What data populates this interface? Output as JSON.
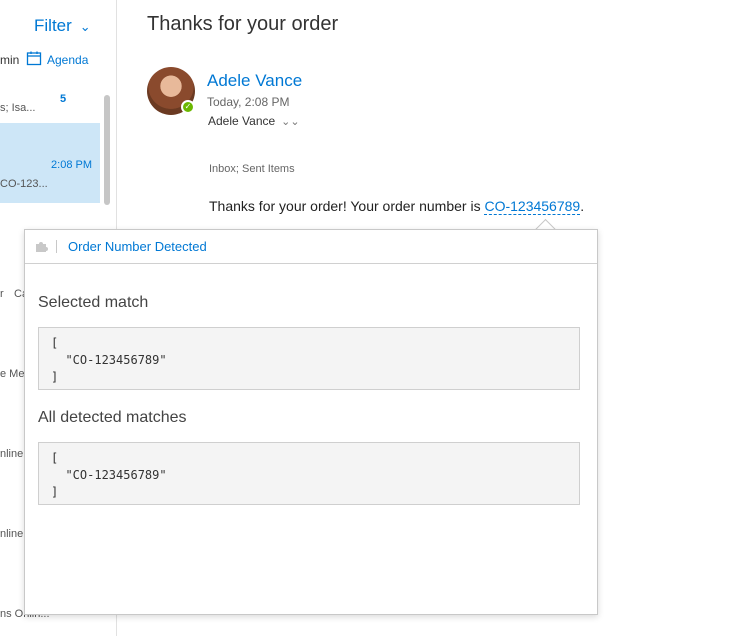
{
  "left_pane": {
    "filter_label": "Filter",
    "view_prefix": "min",
    "agenda_label": "Agenda",
    "messages": [
      {
        "snippet": "s; Isa...",
        "count": "5"
      },
      {
        "time": "2:08 PM",
        "snippet": "CO-123..."
      }
    ],
    "fragments": [
      "r",
      "Ca",
      "e Me",
      "nline",
      "nline",
      "ns Onlin..."
    ]
  },
  "reading_pane": {
    "subject": "Thanks for your order",
    "sender_name": "Adele Vance",
    "sent_time": "Today, 2:08 PM",
    "to": "Adele Vance",
    "folders": "Inbox; Sent Items",
    "body_prefix": "Thanks for your order! Your order number is ",
    "order_number": "CO-123456789",
    "body_suffix": "."
  },
  "callout": {
    "title": "Order Number Detected",
    "selected_label": "Selected match",
    "selected_code": [
      "[",
      "  \"CO-123456789\"",
      "]"
    ],
    "all_label": "All detected matches",
    "all_code": [
      "[",
      "  \"CO-123456789\"",
      "]"
    ]
  },
  "icons": {
    "filter": "chevron-down-icon",
    "calendar": "calendar-icon",
    "presence": "presence-available-icon",
    "expand": "double-chevron-down-icon",
    "addin": "puzzle-icon"
  },
  "colors": {
    "accent": "#0078d4",
    "selected_row": "#cde6f7",
    "presence": "#6bb700"
  }
}
